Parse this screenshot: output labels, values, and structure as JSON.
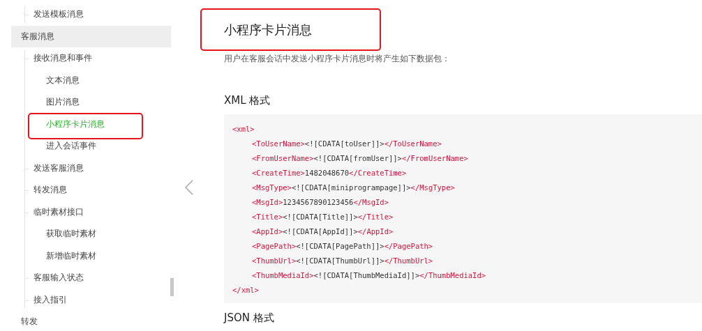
{
  "sidebar": {
    "items": [
      {
        "children": [
          {
            "label": "发送模板消息",
            "selected": false,
            "highlighted": false
          }
        ]
      },
      {
        "label": "客服消息",
        "selected": false,
        "highlighted": true,
        "children": [
          {
            "label": "接收消息和事件",
            "selected": false,
            "highlighted": false,
            "children": [
              {
                "label": "文本消息",
                "selected": false,
                "highlighted": false
              },
              {
                "label": "图片消息",
                "selected": false,
                "highlighted": false
              },
              {
                "label": "小程序卡片消息",
                "selected": true,
                "highlighted": false
              },
              {
                "label": "进入会话事件",
                "selected": false,
                "highlighted": false
              }
            ]
          },
          {
            "label": "发送客服消息",
            "selected": false,
            "highlighted": false
          },
          {
            "label": "转发消息",
            "selected": false,
            "highlighted": false
          },
          {
            "label": "临时素材接口",
            "selected": false,
            "highlighted": false,
            "children": [
              {
                "label": "获取临时素材",
                "selected": false,
                "highlighted": false
              },
              {
                "label": "新增临时素材",
                "selected": false,
                "highlighted": false
              }
            ]
          },
          {
            "label": "客服输入状态",
            "selected": false,
            "highlighted": false
          },
          {
            "label": "接入指引",
            "selected": false,
            "highlighted": false
          }
        ]
      },
      {
        "label": "转发",
        "selected": false,
        "highlighted": false
      }
    ]
  },
  "annotations": {
    "title_boxed": true,
    "selected_item_boxed": true
  },
  "content": {
    "title": "小程序卡片消息",
    "description": "用户在客服会话中发送小程序卡片消息时将产生如下数据包：",
    "sections": [
      {
        "heading": "XML 格式",
        "code": [
          {
            "open": "<xml>",
            "close": "</xml>",
            "children": [
              {
                "open": "<ToUserName>",
                "value": "<![CDATA[toUser]]>",
                "close": "</ToUserName>"
              },
              {
                "open": "<FromUserName>",
                "value": "<![CDATA[fromUser]]>",
                "close": "</FromUserName>"
              },
              {
                "open": "<CreateTime>",
                "value": "1482048670",
                "close": "</CreateTime>"
              },
              {
                "open": "<MsgType>",
                "value": "<![CDATA[miniprogrampage]]>",
                "close": "</MsgType>"
              },
              {
                "open": "<MsgId>",
                "value": "1234567890123456",
                "close": "</MsgId>"
              },
              {
                "open": "<Title>",
                "value": "<![CDATA[Title]]>",
                "close": "</Title>"
              },
              {
                "open": "<AppId>",
                "value": "<![CDATA[AppId]]>",
                "close": "</AppId>"
              },
              {
                "open": "<PagePath>",
                "value": "<![CDATA[PagePath]]>",
                "close": "</PagePath>"
              },
              {
                "open": "<ThumbUrl>",
                "value": "<![CDATA[ThumbUrl]]>",
                "close": "</ThumbUrl>"
              },
              {
                "open": "<ThumbMediaId>",
                "value": "<![CDATA[ThumbMediaId]]>",
                "close": "</ThumbMediaId>"
              }
            ]
          }
        ]
      },
      {
        "heading": "JSON 格式"
      }
    ]
  }
}
